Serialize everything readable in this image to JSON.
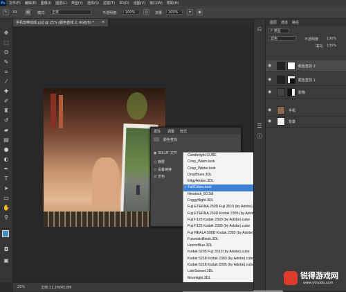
{
  "app": {
    "logo": "Ps"
  },
  "menu": [
    "文件(F)",
    "编辑(E)",
    "图像(I)",
    "图层(L)",
    "类型(Y)",
    "选择(S)",
    "滤镜(T)",
    "3D(D)",
    "视图(V)",
    "窗口(W)",
    "帮助(H)"
  ],
  "options": {
    "brush_size": "33",
    "mode_label": "模式:",
    "mode_value": "正常",
    "opacity_label": "不透明度:",
    "opacity_value": "100%",
    "flow_label": "流量:",
    "flow_value": "100%"
  },
  "document": {
    "tab_title": "手机忽带动成.psd @ 25% (颜色查找 2, RGB/8) *",
    "zoom": "25%",
    "doc_info": "文档:11.2M/45.8M"
  },
  "layers_panel": {
    "tabs": [
      "图层",
      "通道",
      "路径"
    ],
    "kind_label": "P 类型",
    "blend_mode": "滤色",
    "opacity_label": "不透明度:",
    "opacity_value": "100%",
    "fill_label": "填充:",
    "fill_value": "100%",
    "layers": [
      {
        "name": "颜色查找 2"
      },
      {
        "name": "颜色查找 1"
      },
      {
        "name": "影物"
      },
      {
        "name": "手机"
      },
      {
        "name": "背景"
      }
    ]
  },
  "properties": {
    "tabs": [
      "属性",
      "调整",
      "样式"
    ],
    "title": "颜色查找",
    "rows": [
      "3DLUT 文件",
      "摘要",
      "设备链接",
      "仿色"
    ]
  },
  "lut_list": {
    "items": [
      "Candlelight.CUBE",
      "Crisp_Warm.look",
      "Crisp_Winter.look",
      "DropBlues.3DL",
      "EdgyAmber.3DL",
      "FallColors.look",
      "filmstock_50.3dl",
      "FoggyNight.3DL",
      "Fuji ETERNA 250D Fuji 3510 (by Adobe).cube",
      "Fuji ETERNA 250D Kodak 2395 (by Adobe).cube",
      "Fuji F125 Kodak 2393 (by Adobe).cube",
      "Fuji F125 Kodak 2395 (by Adobe).cube",
      "Fuji REALA 500D Kodak 2393 (by Adobe).cube",
      "FuturisticBleak.3DL",
      "HorrorBlue.3DL",
      "Kodak 5205 Fuji 3510 (by Adobe).cube",
      "Kodak 5218 Kodak 2383 (by Adobe).cube",
      "Kodak 5218 Kodak 2395 (by Adobe).cube",
      "LateSunset.3DL",
      "Moonlight.3DL",
      "NightFromDay.CUBE"
    ],
    "selected_index": 5,
    "check": "✓"
  },
  "watermark": {
    "brand": "锐得游戏网",
    "url": "www.ytruido.com"
  },
  "colors": {
    "selection": "#3f7fd4",
    "ps_blue": "#31a8ff",
    "panel": "#3b3b3b"
  }
}
